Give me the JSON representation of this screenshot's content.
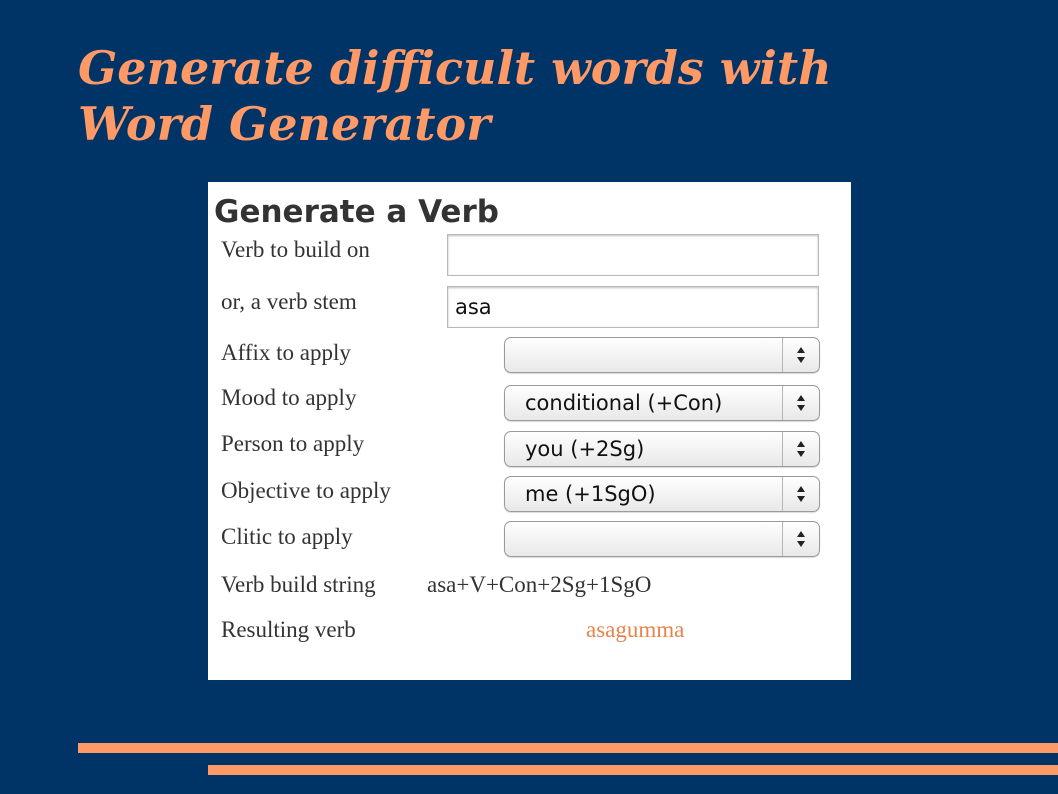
{
  "slide": {
    "title_line1": "Generate difficult words with",
    "title_line2": "Word Generator"
  },
  "form": {
    "heading": "Generate a Verb",
    "verb_to_build_on": {
      "label": "Verb to build on",
      "value": ""
    },
    "verb_stem": {
      "label": "or, a verb stem",
      "value": "asa"
    },
    "affix": {
      "label": "Affix to apply",
      "selected": ""
    },
    "mood": {
      "label": "Mood to apply",
      "selected": "conditional (+Con)"
    },
    "person": {
      "label": "Person to apply",
      "selected": "you (+2Sg)"
    },
    "objective": {
      "label": "Objective to apply",
      "selected": "me (+1SgO)"
    },
    "clitic": {
      "label": "Clitic to apply",
      "selected": ""
    },
    "build_string": {
      "label": "Verb build string",
      "value": "asa+V+Con+2Sg+1SgO"
    },
    "result": {
      "label": "Resulting verb",
      "value": "asagumma"
    }
  },
  "colors": {
    "background": "#003366",
    "accent": "#ff9966",
    "result_text": "#e8844a"
  },
  "icons": {
    "select_arrows": "up-down-arrows-icon"
  }
}
